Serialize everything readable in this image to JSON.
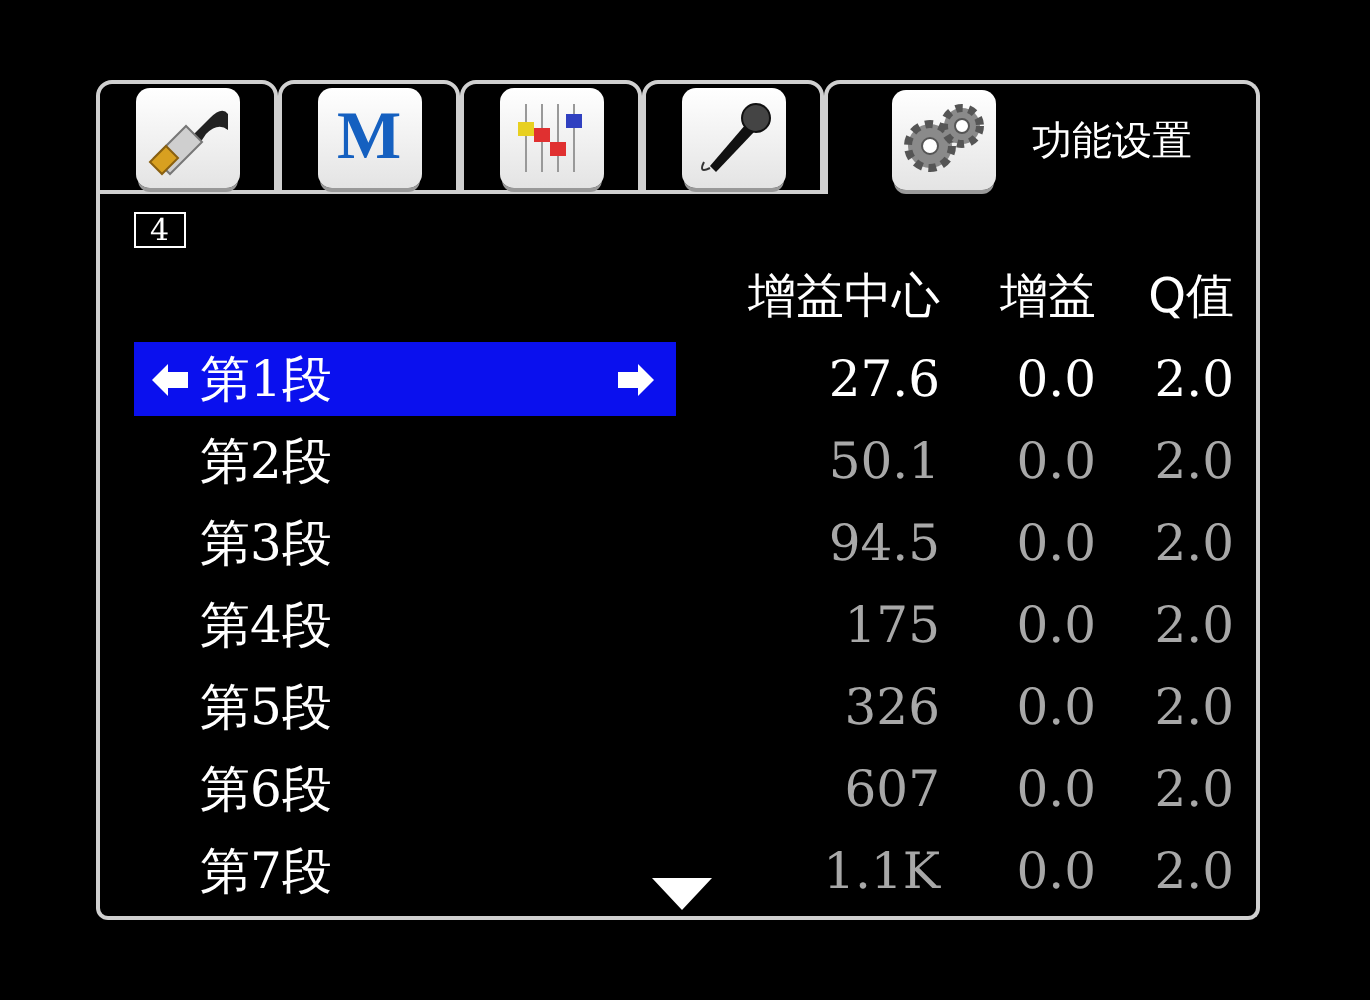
{
  "tabs": [
    {
      "selected": false
    },
    {
      "icon_text": "M",
      "selected": false
    },
    {
      "selected": false
    },
    {
      "selected": false
    },
    {
      "label": "功能设置",
      "selected": true
    }
  ],
  "page_indicator": "4",
  "columns": [
    "增益中心",
    "增益",
    "Q值"
  ],
  "rows": [
    {
      "label": "第1段",
      "values": [
        "27.6",
        "0.0",
        "2.0"
      ],
      "selected": true
    },
    {
      "label": "第2段",
      "values": [
        "50.1",
        "0.0",
        "2.0"
      ],
      "selected": false
    },
    {
      "label": "第3段",
      "values": [
        "94.5",
        "0.0",
        "2.0"
      ],
      "selected": false
    },
    {
      "label": "第4段",
      "values": [
        "175",
        "0.0",
        "2.0"
      ],
      "selected": false
    },
    {
      "label": "第5段",
      "values": [
        "326",
        "0.0",
        "2.0"
      ],
      "selected": false
    },
    {
      "label": "第6段",
      "values": [
        "607",
        "0.0",
        "2.0"
      ],
      "selected": false
    },
    {
      "label": "第7段",
      "values": [
        "1.1K",
        "0.0",
        "2.0"
      ],
      "selected": false
    }
  ]
}
